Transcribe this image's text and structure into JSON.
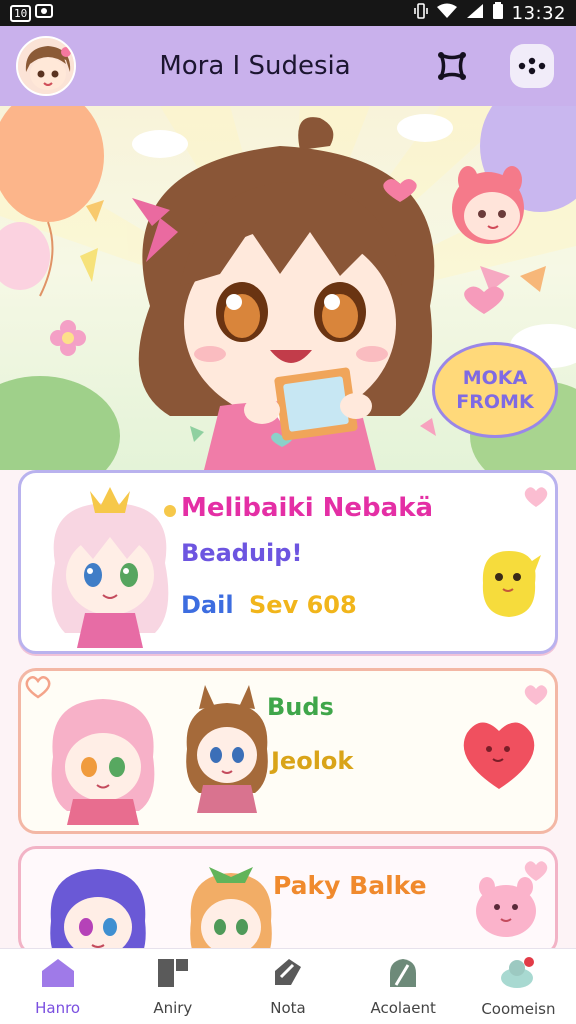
{
  "status_bar": {
    "left_badge": "10",
    "time": "13:32",
    "icons": [
      "vibrate-icon",
      "wifi-icon",
      "signal-icon",
      "battery-icon"
    ]
  },
  "header": {
    "title": "Mora I Sudesia",
    "icons": [
      "profile-avatar",
      "link-icon",
      "more-options-icon"
    ]
  },
  "hero": {
    "speech_bubble": {
      "line1": "MOKA",
      "line2": "FROMK"
    }
  },
  "cards": [
    {
      "title": "Melibaiki Nebakä",
      "subtitle": "Beaduip!",
      "line_label": "Dail",
      "line_value": "Sev 608"
    },
    {
      "title": "Buds",
      "subtitle": "Jeolok"
    },
    {
      "title": "Paky Balke"
    }
  ],
  "bottom_nav": {
    "items": [
      {
        "label": "Hanro",
        "icon": "home-icon",
        "active": true
      },
      {
        "label": "Aniry",
        "icon": "grid-icon",
        "active": false
      },
      {
        "label": "Nota",
        "icon": "note-icon",
        "active": false
      },
      {
        "label": "Acolaent",
        "icon": "leaf-icon",
        "active": false
      },
      {
        "label": "Coomeisn",
        "icon": "chat-bubble-icon",
        "active": false
      }
    ]
  },
  "colors": {
    "header_bg": "#c9b1ec",
    "accent_active": "#7a4fe0",
    "title_pink": "#e42fa5",
    "subtitle_purple": "#6d55e0",
    "label_blue": "#3d6de0",
    "value_yellow": "#f1b51b",
    "green_title": "#3fa64a",
    "orange_title": "#f08a2d"
  }
}
